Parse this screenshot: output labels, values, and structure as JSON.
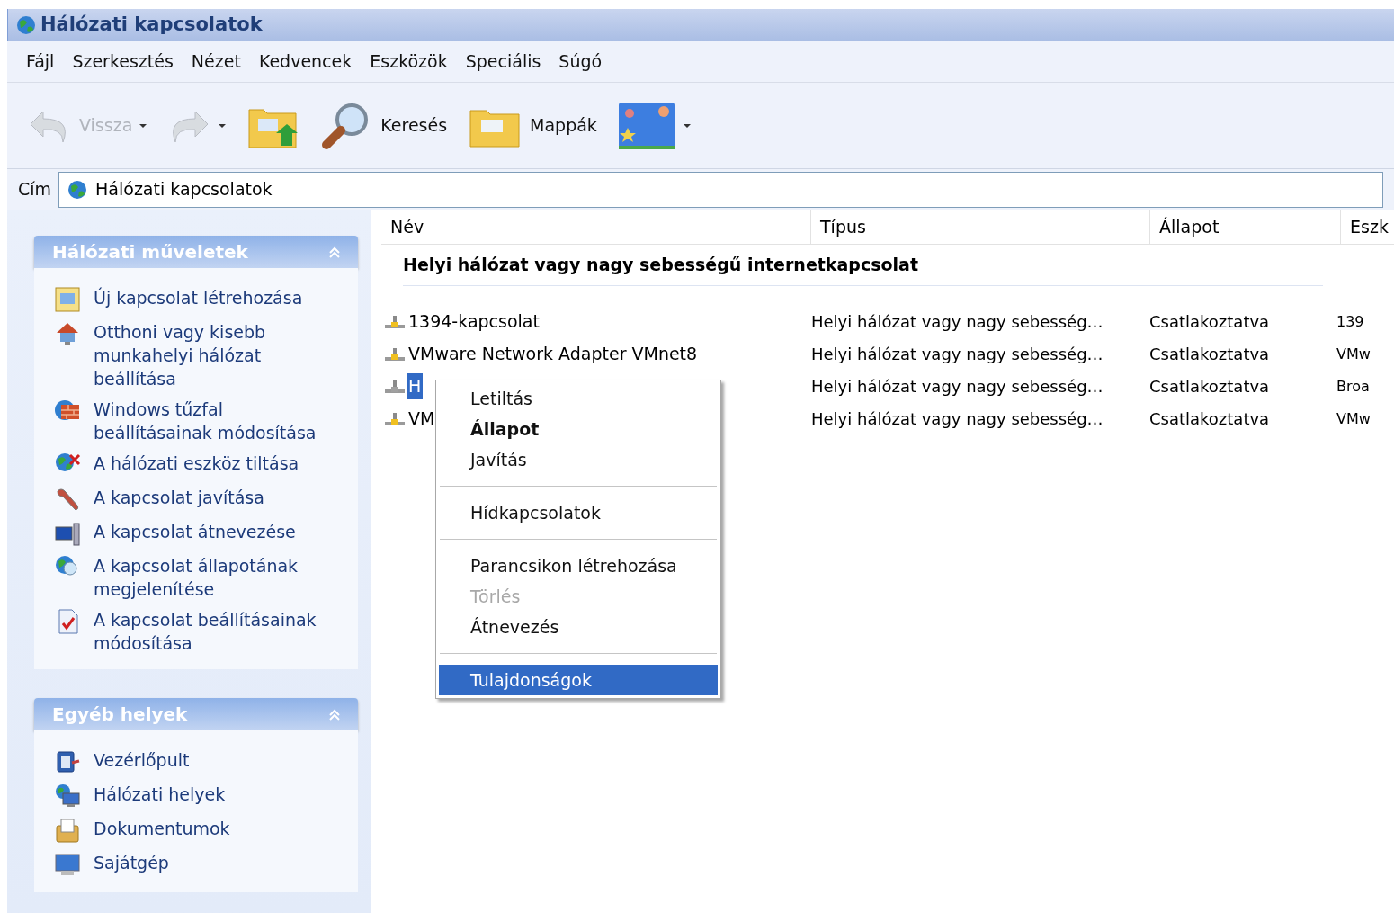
{
  "window": {
    "title": "Hálózati kapcsolatok"
  },
  "menu_bar": [
    "Fájl",
    "Szerkesztés",
    "Nézet",
    "Kedvencek",
    "Eszközök",
    "Speciális",
    "Súgó"
  ],
  "toolbar": [
    {
      "kind": "back",
      "label": "Vissza",
      "disabled": true
    },
    {
      "kind": "forward",
      "disabled": true
    },
    {
      "kind": "up"
    },
    {
      "kind": "search",
      "label": "Keresés"
    },
    {
      "kind": "folders",
      "label": "Mappák"
    },
    {
      "kind": "views"
    }
  ],
  "address_bar": {
    "label": "Cím",
    "value": "Hálózati kapcsolatok"
  },
  "sidebar": {
    "panels": [
      {
        "title": "Hálózati műveletek",
        "expanded": true,
        "items": [
          {
            "label": "Új kapcsolat létrehozása"
          },
          {
            "label": "Otthoni vagy kisebb munkahelyi hálózat beállítása"
          },
          {
            "label": "Windows tűzfal beállításainak módosítása"
          },
          {
            "label": "A hálózati eszköz tiltása"
          },
          {
            "label": "A kapcsolat javítása"
          },
          {
            "label": "A kapcsolat átnevezése"
          },
          {
            "label": "A kapcsolat állapotának megjelenítése"
          },
          {
            "label": "A kapcsolat beállításainak módosítása"
          }
        ]
      },
      {
        "title": "Egyéb helyek",
        "expanded": true,
        "items": [
          {
            "label": "Vezérlőpult"
          },
          {
            "label": "Hálózati helyek"
          },
          {
            "label": "Dokumentumok"
          },
          {
            "label": "Sajátgép"
          }
        ]
      }
    ]
  },
  "table": {
    "columns": [
      "Név",
      "Típus",
      "Állapot",
      "Eszk"
    ],
    "group": "Helyi hálózat vagy nagy sebességű internetkapcsolat",
    "rows": [
      {
        "name": "1394-kapcsolat",
        "type": "Helyi hálózat vagy nagy sebesség…",
        "status": "Csatlakoztatva",
        "column_4": "139",
        "selected": false,
        "active": true
      },
      {
        "name": "VMware Network Adapter VMnet8",
        "type": "Helyi hálózat vagy nagy sebesség…",
        "status": "Csatlakoztatva",
        "column_4": "VMw",
        "selected": false,
        "active": true
      },
      {
        "name": "H",
        "type": "Helyi hálózat vagy nagy sebesség…",
        "status": "Csatlakoztatva",
        "column_4": "Broa",
        "selected": true,
        "active": false
      },
      {
        "name": "VM",
        "type": "Helyi hálózat vagy nagy sebesség…",
        "status": "Csatlakoztatva",
        "column_4": "VMw",
        "selected": false,
        "active": true
      }
    ]
  },
  "context_menu": [
    {
      "kind": "item",
      "label": "Letiltás",
      "selected": false
    },
    {
      "kind": "default",
      "label": "Állapot",
      "selected": false
    },
    {
      "kind": "item",
      "label": "Javítás",
      "selected": false
    },
    {
      "kind": "separator"
    },
    {
      "kind": "item",
      "label": "Hídkapcsolatok",
      "selected": false
    },
    {
      "kind": "separator"
    },
    {
      "kind": "item",
      "label": "Parancsikon létrehozása",
      "selected": false
    },
    {
      "kind": "disabled",
      "label": "Törlés",
      "selected": false
    },
    {
      "kind": "item",
      "label": "Átnevezés",
      "selected": false
    },
    {
      "kind": "separator"
    },
    {
      "kind": "item",
      "label": "Tulajdonságok",
      "selected": true
    }
  ]
}
